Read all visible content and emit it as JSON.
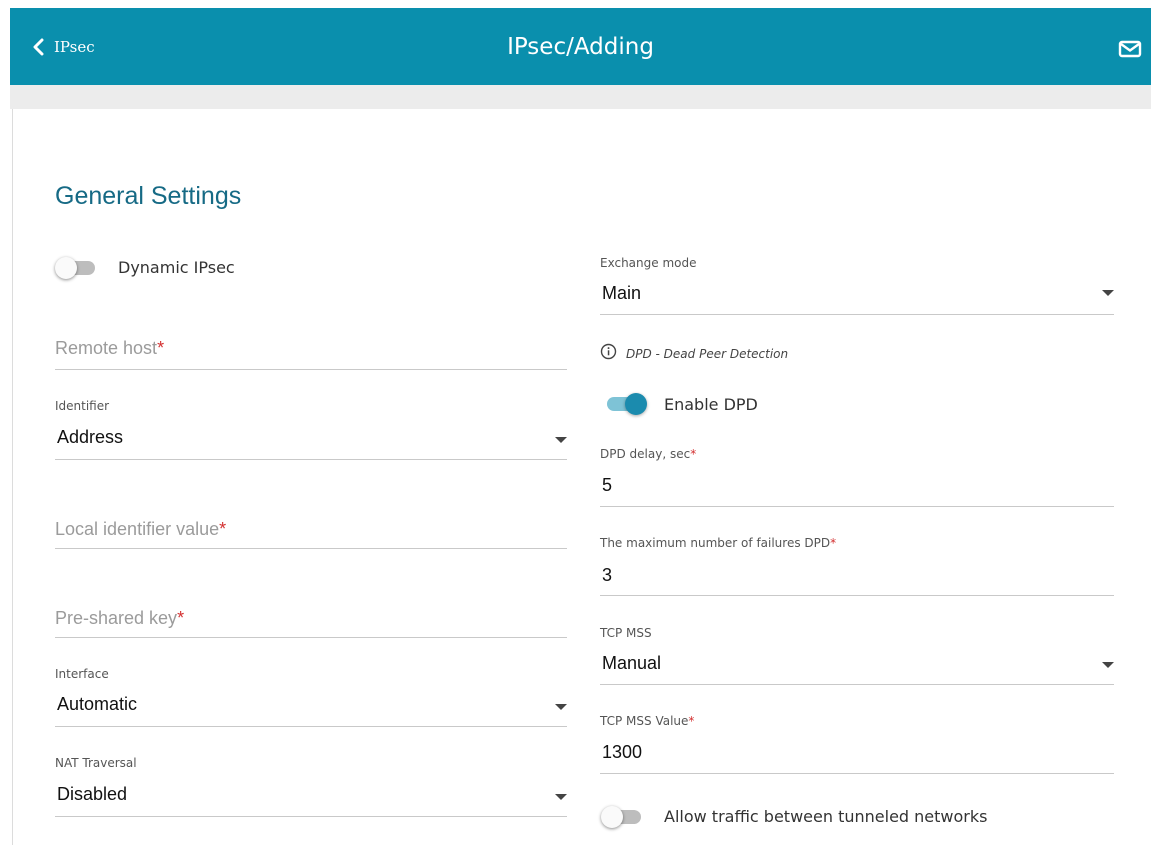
{
  "header": {
    "back_label": "IPsec",
    "title": "IPsec/Adding",
    "icons": {
      "back": "chevron-left-icon",
      "mail": "envelope-icon"
    }
  },
  "colors": {
    "header_bg": "#0a8fad",
    "accent": "#1b8bae",
    "section_title": "#166a85",
    "required": "#d32f2f"
  },
  "general": {
    "section_title": "General Settings",
    "dynamic_ipsec": {
      "label": "Dynamic IPsec",
      "enabled": false
    },
    "remote_host": {
      "placeholder": "Remote host",
      "value": ""
    },
    "identifier": {
      "label": "Identifier",
      "value": "Address"
    },
    "local_identifier": {
      "placeholder": "Local identifier value",
      "value": ""
    },
    "preshared_key": {
      "placeholder": "Pre-shared key",
      "value": ""
    },
    "interface": {
      "label": "Interface",
      "value": "Automatic"
    },
    "nat_traversal": {
      "label": "NAT Traversal",
      "value": "Disabled"
    },
    "exchange_mode": {
      "label": "Exchange mode",
      "value": "Main"
    },
    "dpd_info": "DPD - Dead Peer Detection",
    "enable_dpd": {
      "label": "Enable DPD",
      "enabled": true
    },
    "dpd_delay": {
      "label": "DPD delay, sec",
      "value": "5"
    },
    "dpd_max_failures": {
      "label": "The maximum number of failures DPD",
      "value": "3"
    },
    "tcp_mss": {
      "label": "TCP MSS",
      "value": "Manual"
    },
    "tcp_mss_value": {
      "label": "TCP MSS Value",
      "value": "1300"
    },
    "allow_traffic": {
      "label": "Allow traffic between tunneled networks",
      "enabled": false
    },
    "required_mark": "*"
  }
}
